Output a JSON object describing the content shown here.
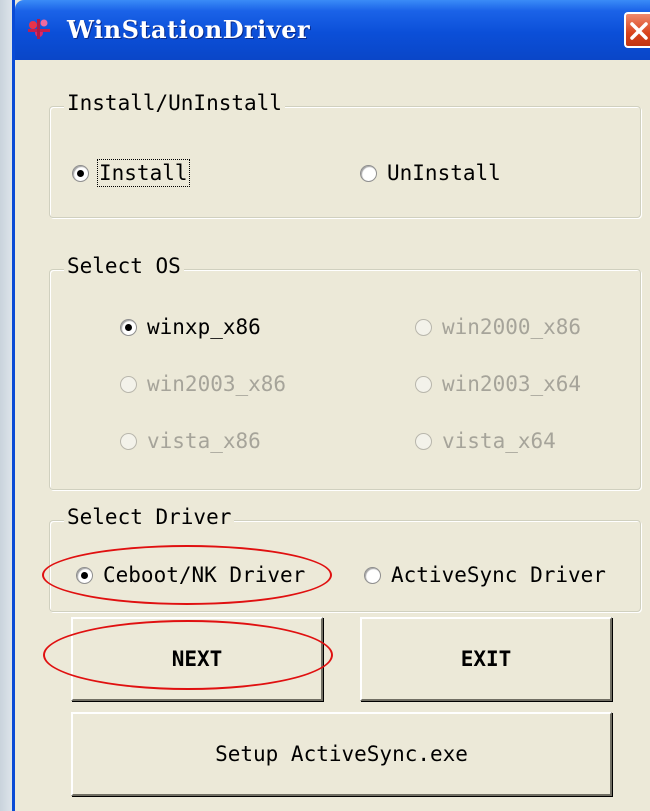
{
  "window": {
    "title": "WinStationDriver"
  },
  "install_group": {
    "legend": "Install/UnInstall",
    "options": [
      {
        "label": "Install",
        "checked": true
      },
      {
        "label": "UnInstall",
        "checked": false
      }
    ]
  },
  "os_group": {
    "legend": "Select OS",
    "options": [
      {
        "label": "winxp_x86",
        "checked": true,
        "enabled": true
      },
      {
        "label": "win2000_x86",
        "checked": false,
        "enabled": false
      },
      {
        "label": "win2003_x86",
        "checked": false,
        "enabled": false
      },
      {
        "label": "win2003_x64",
        "checked": false,
        "enabled": false
      },
      {
        "label": "vista_x86",
        "checked": false,
        "enabled": false
      },
      {
        "label": "vista_x64",
        "checked": false,
        "enabled": false
      }
    ]
  },
  "driver_group": {
    "legend": "Select Driver",
    "options": [
      {
        "label": "Ceboot/NK Driver",
        "checked": true
      },
      {
        "label": "ActiveSync Driver",
        "checked": false
      }
    ]
  },
  "buttons": {
    "next": "NEXT",
    "exit": "EXIT",
    "setup": "Setup ActiveSync.exe"
  },
  "colors": {
    "titlebar": "#0b4fd8",
    "dialog_bg": "#ece9d8",
    "annotation": "#e01010"
  }
}
